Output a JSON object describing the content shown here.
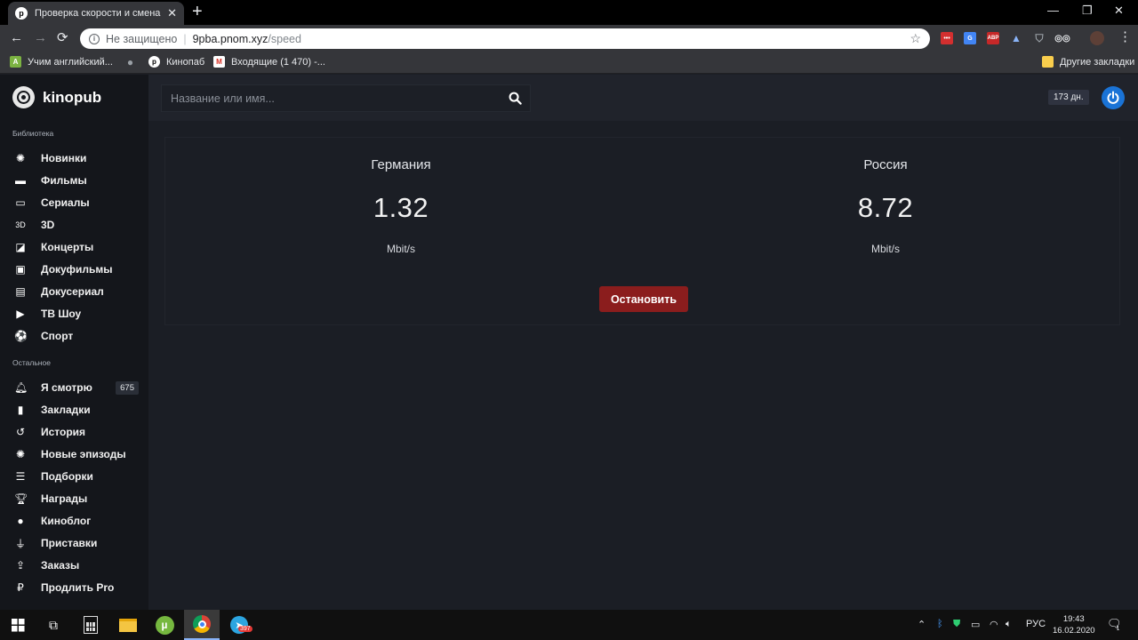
{
  "browser": {
    "tab_title": "Проверка скорости и смена сер",
    "tab_favicon": "p",
    "address": {
      "security": "Не защищено",
      "host": "9pba.pnom.xyz",
      "path": "/speed"
    },
    "bookmarks": [
      {
        "label": "Учим английский...",
        "icon": "android-icon"
      },
      {
        "label": "",
        "icon": "apple-icon"
      },
      {
        "label": "Кинопаб",
        "icon": "kinopub-icon"
      },
      {
        "label": "Входящие (1 470) -...",
        "icon": "gmail-icon"
      }
    ],
    "other_bookmarks": "Другие закладки"
  },
  "app": {
    "name": "kinopub",
    "search_placeholder": "Название или имя...",
    "days_badge": "173 дн."
  },
  "sidebar": {
    "library_title": "Библиотека",
    "library": [
      {
        "label": "Новинки",
        "icon": "new-icon"
      },
      {
        "label": "Фильмы",
        "icon": "film-icon"
      },
      {
        "label": "Сериалы",
        "icon": "tv-icon"
      },
      {
        "label": "3D",
        "icon": "3d-icon"
      },
      {
        "label": "Концерты",
        "icon": "concert-icon"
      },
      {
        "label": "Докуфильмы",
        "icon": "docfilm-icon"
      },
      {
        "label": "Докусериал",
        "icon": "docuserial-icon"
      },
      {
        "label": "ТВ Шоу",
        "icon": "tvshow-icon"
      },
      {
        "label": "Спорт",
        "icon": "sport-icon"
      }
    ],
    "other_title": "Остальное",
    "other": [
      {
        "label": "Я смотрю",
        "icon": "bell-icon",
        "count": "675"
      },
      {
        "label": "Закладки",
        "icon": "bookmark-icon"
      },
      {
        "label": "История",
        "icon": "history-icon"
      },
      {
        "label": "Новые эпизоды",
        "icon": "new-episodes-icon"
      },
      {
        "label": "Подборки",
        "icon": "list-icon"
      },
      {
        "label": "Награды",
        "icon": "trophy-icon"
      },
      {
        "label": "Киноблог",
        "icon": "chat-icon"
      },
      {
        "label": "Приставки",
        "icon": "plug-icon"
      },
      {
        "label": "Заказы",
        "icon": "upload-icon"
      },
      {
        "label": "Продлить Pro",
        "icon": "ruble-icon"
      }
    ]
  },
  "speed": {
    "germany": {
      "country": "Германия",
      "value": "1.32",
      "unit": "Mbit/s"
    },
    "russia": {
      "country": "Россия",
      "value": "8.72",
      "unit": "Mbit/s"
    },
    "stop_label": "Остановить"
  },
  "taskbar": {
    "lang": "РУС",
    "time": "19:43",
    "date": "16.02.2020",
    "telegram_badge": "397",
    "notification_badge": "1"
  },
  "colors": {
    "accent_blue": "#1a73d6",
    "stop_red": "#8b1d1d"
  }
}
